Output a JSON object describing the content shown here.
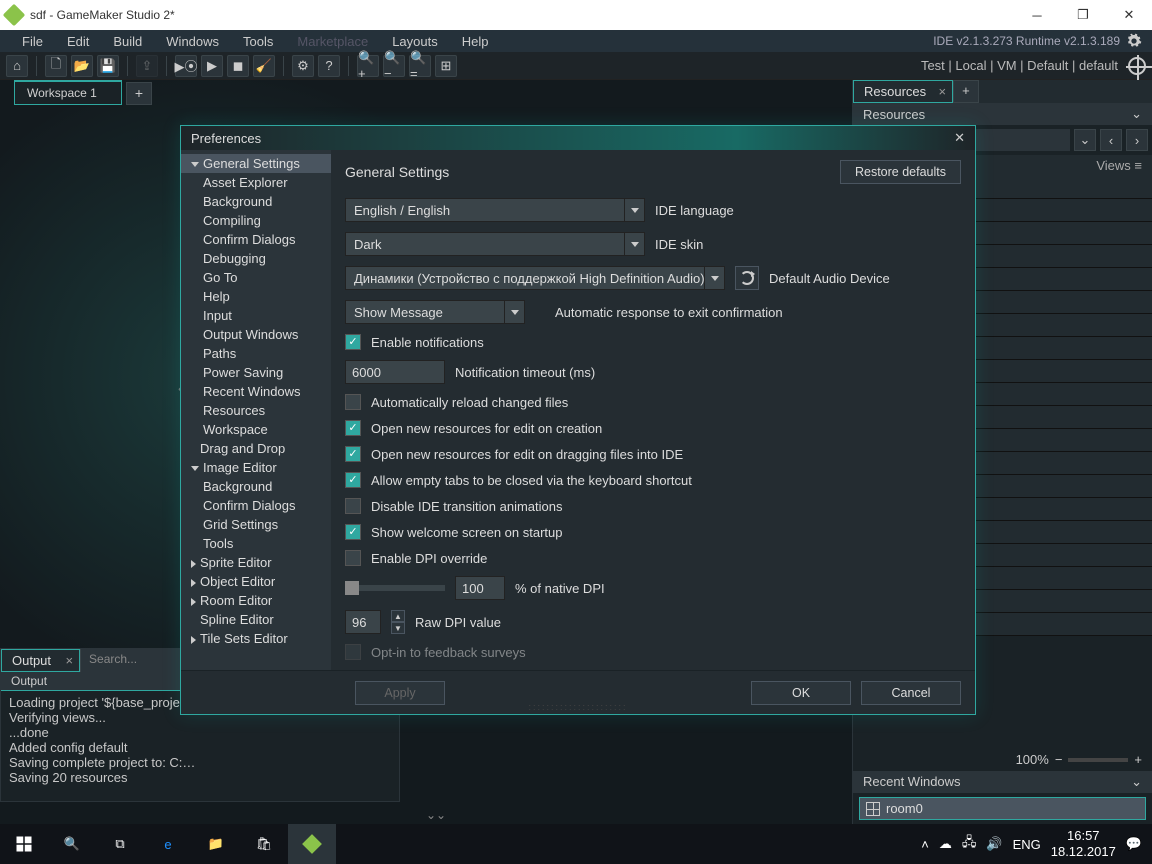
{
  "window": {
    "title": "sdf - GameMaker Studio 2*"
  },
  "menubar": {
    "items": [
      "File",
      "Edit",
      "Build",
      "Windows",
      "Tools",
      "Marketplace",
      "Layouts",
      "Help"
    ],
    "ide": "IDE v2.1.3.273 Runtime v2.1.3.189"
  },
  "toolbar_status": "Test  |  Local  |  VM  |  Default  |  default",
  "workspace": {
    "tab": "Workspace 1",
    "add": "+"
  },
  "output": {
    "tab": "Output",
    "sub": "Output",
    "search_placeholder": "Search...",
    "lines": [
      "Loading project '${base_proje…",
      "Verifying views...",
      "...done",
      "Added config default",
      "Saving complete project to: C:…",
      "Saving 20 resources"
    ]
  },
  "resources": {
    "tab": "Resources",
    "add": "+",
    "header": "Resources",
    "views": "Views ≡",
    "zoom": "100%",
    "recent_hdr": "Recent Windows",
    "recent_item": "room0"
  },
  "dialog": {
    "title": "Preferences",
    "tree": [
      {
        "label": "General Settings",
        "lv": 1,
        "arrow": "down",
        "sel": true
      },
      {
        "label": "Asset Explorer",
        "lv": 2
      },
      {
        "label": "Background",
        "lv": 2
      },
      {
        "label": "Compiling",
        "lv": 2
      },
      {
        "label": "Confirm Dialogs",
        "lv": 2
      },
      {
        "label": "Debugging",
        "lv": 2
      },
      {
        "label": "Go To",
        "lv": 2
      },
      {
        "label": "Help",
        "lv": 2
      },
      {
        "label": "Input",
        "lv": 2
      },
      {
        "label": "Output Windows",
        "lv": 2
      },
      {
        "label": "Paths",
        "lv": 2
      },
      {
        "label": "Power Saving",
        "lv": 2
      },
      {
        "label": "Recent Windows",
        "lv": 2
      },
      {
        "label": "Resources",
        "lv": 2
      },
      {
        "label": "Workspace",
        "lv": 2
      },
      {
        "label": "Drag and Drop",
        "lv": 1
      },
      {
        "label": "Image Editor",
        "lv": 1,
        "arrow": "down"
      },
      {
        "label": "Background",
        "lv": 2
      },
      {
        "label": "Confirm Dialogs",
        "lv": 2
      },
      {
        "label": "Grid Settings",
        "lv": 2
      },
      {
        "label": "Tools",
        "lv": 2
      },
      {
        "label": "Sprite Editor",
        "lv": 1,
        "arrow": "right"
      },
      {
        "label": "Object Editor",
        "lv": 1,
        "arrow": "right"
      },
      {
        "label": "Room Editor",
        "lv": 1,
        "arrow": "right"
      },
      {
        "label": "Spline Editor",
        "lv": 1
      },
      {
        "label": "Tile Sets Editor",
        "lv": 1,
        "arrow": "right"
      }
    ],
    "content": {
      "heading": "General Settings",
      "restore": "Restore defaults",
      "language": {
        "value": "English / English",
        "label": "IDE language"
      },
      "skin": {
        "value": "Dark",
        "label": "IDE skin"
      },
      "audio": {
        "value": "Динамики (Устройство с поддержкой High Definition Audio)",
        "label": "Default Audio Device"
      },
      "exit": {
        "value": "Show Message",
        "label": "Automatic response to exit confirmation"
      },
      "checks": [
        {
          "checked": true,
          "label": "Enable notifications"
        },
        {
          "input": "6000",
          "label": "Notification timeout (ms)"
        },
        {
          "checked": false,
          "label": "Automatically reload changed files"
        },
        {
          "checked": true,
          "label": "Open new resources for edit on creation"
        },
        {
          "checked": true,
          "label": "Open new resources for edit on dragging files into IDE"
        },
        {
          "checked": true,
          "label": "Allow empty tabs to be closed via the keyboard shortcut"
        },
        {
          "checked": false,
          "label": "Disable IDE transition animations"
        },
        {
          "checked": true,
          "label": "Show welcome screen on startup"
        },
        {
          "checked": false,
          "label": "Enable DPI override"
        }
      ],
      "dpi": {
        "pct": "100",
        "pct_label": "% of native DPI",
        "raw": "96",
        "raw_label": "Raw DPI value"
      },
      "feedback": {
        "checked": false,
        "label": "Opt-in to feedback surveys"
      },
      "apply": "Apply",
      "ok": "OK",
      "cancel": "Cancel"
    }
  },
  "taskbar": {
    "lang": "ENG",
    "time": "16:57",
    "date": "18.12.2017"
  }
}
